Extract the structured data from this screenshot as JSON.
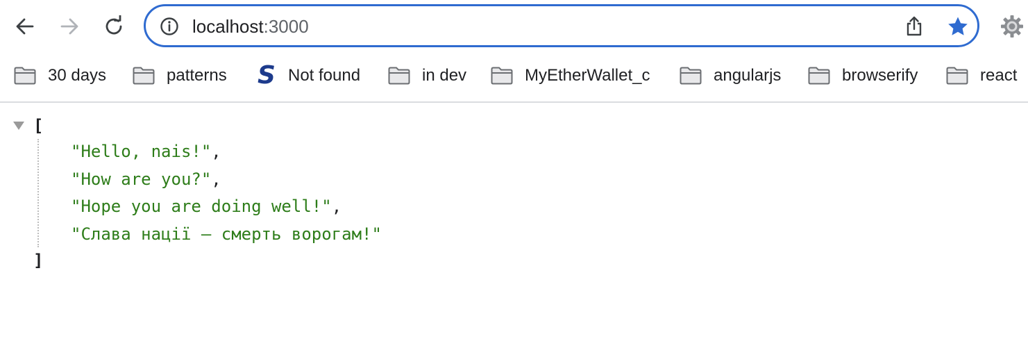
{
  "browser": {
    "url_host": "localhost",
    "url_port": ":3000",
    "star_color": "#2f6bd0",
    "accent_color": "#2f6bd0"
  },
  "bookmarks": [
    {
      "label": "30 days",
      "icon": "folder-icon"
    },
    {
      "label": "patterns",
      "icon": "folder-icon"
    },
    {
      "label": "Not found",
      "icon": "s-logo-icon",
      "logo_letter": "S"
    },
    {
      "label": "in dev",
      "icon": "folder-icon"
    },
    {
      "label": "MyEtherWallet_c",
      "icon": "folder-icon"
    },
    {
      "label": "angularjs",
      "icon": "folder-icon"
    },
    {
      "label": "browserify",
      "icon": "folder-icon"
    },
    {
      "label": "react",
      "icon": "folder-icon"
    }
  ],
  "json_view": {
    "open_bracket": "[",
    "close_bracket": "]",
    "items": [
      {
        "value": "\"Hello, nais!\"",
        "sep": ","
      },
      {
        "value": "\"How are you?\"",
        "sep": ","
      },
      {
        "value": "\"Hope you are doing well!\"",
        "sep": ","
      },
      {
        "value": "\"Слава нації — смерть ворогам!\"",
        "sep": ""
      }
    ],
    "string_color": "#2e7d1a"
  }
}
